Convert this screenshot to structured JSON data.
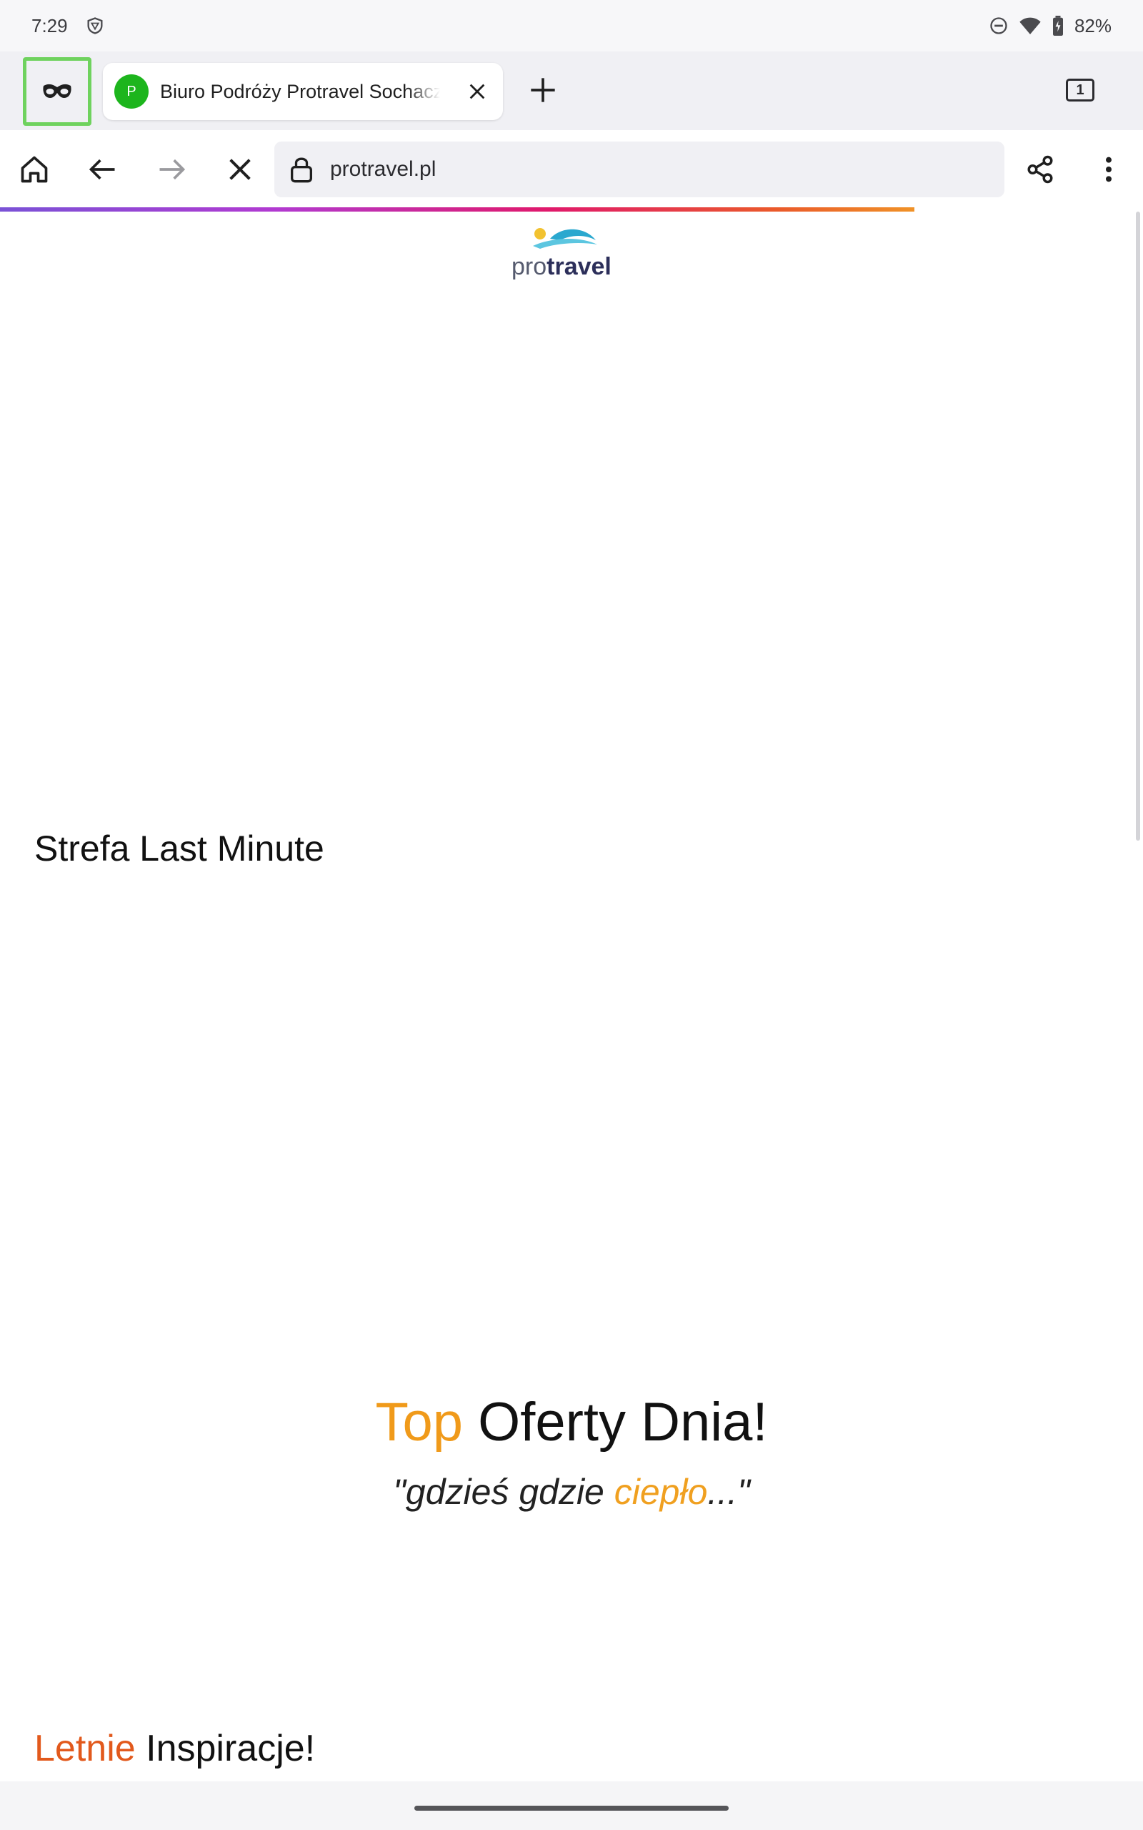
{
  "status_bar": {
    "time": "7:29",
    "battery": "82%",
    "icons": [
      "shield-icon",
      "do-not-disturb-icon",
      "wifi-icon",
      "battery-icon"
    ]
  },
  "tabs": {
    "incognito_icon": "incognito-mask-icon",
    "active_tab": {
      "favicon_letter": "P",
      "favicon_color": "#1db51d",
      "title": "Biuro Podróży Protravel Sochaczew"
    },
    "tab_count": "1"
  },
  "toolbar": {
    "url": "protravel.pl",
    "icons": [
      "home-icon",
      "back-icon",
      "forward-icon",
      "stop-icon",
      "lock-icon",
      "share-icon",
      "more-icon"
    ]
  },
  "load_progress": 0.8,
  "page": {
    "logo": {
      "part1": "pro",
      "part2": "travel"
    },
    "last_minute_heading": "Strefa Last Minute",
    "top_offers": {
      "accent": "Top",
      "rest": " Oferty Dnia!"
    },
    "tagline": {
      "part1": "\"gdzieś gdzie ",
      "accent": "ciepło",
      "part2": "...\""
    },
    "summer": {
      "accent": "Letnie",
      "rest": " Inspiracje!"
    }
  },
  "colors": {
    "accent_orange": "#f09a1a",
    "accent_red": "#e2591c",
    "incognito_highlight": "#6fd25e"
  }
}
